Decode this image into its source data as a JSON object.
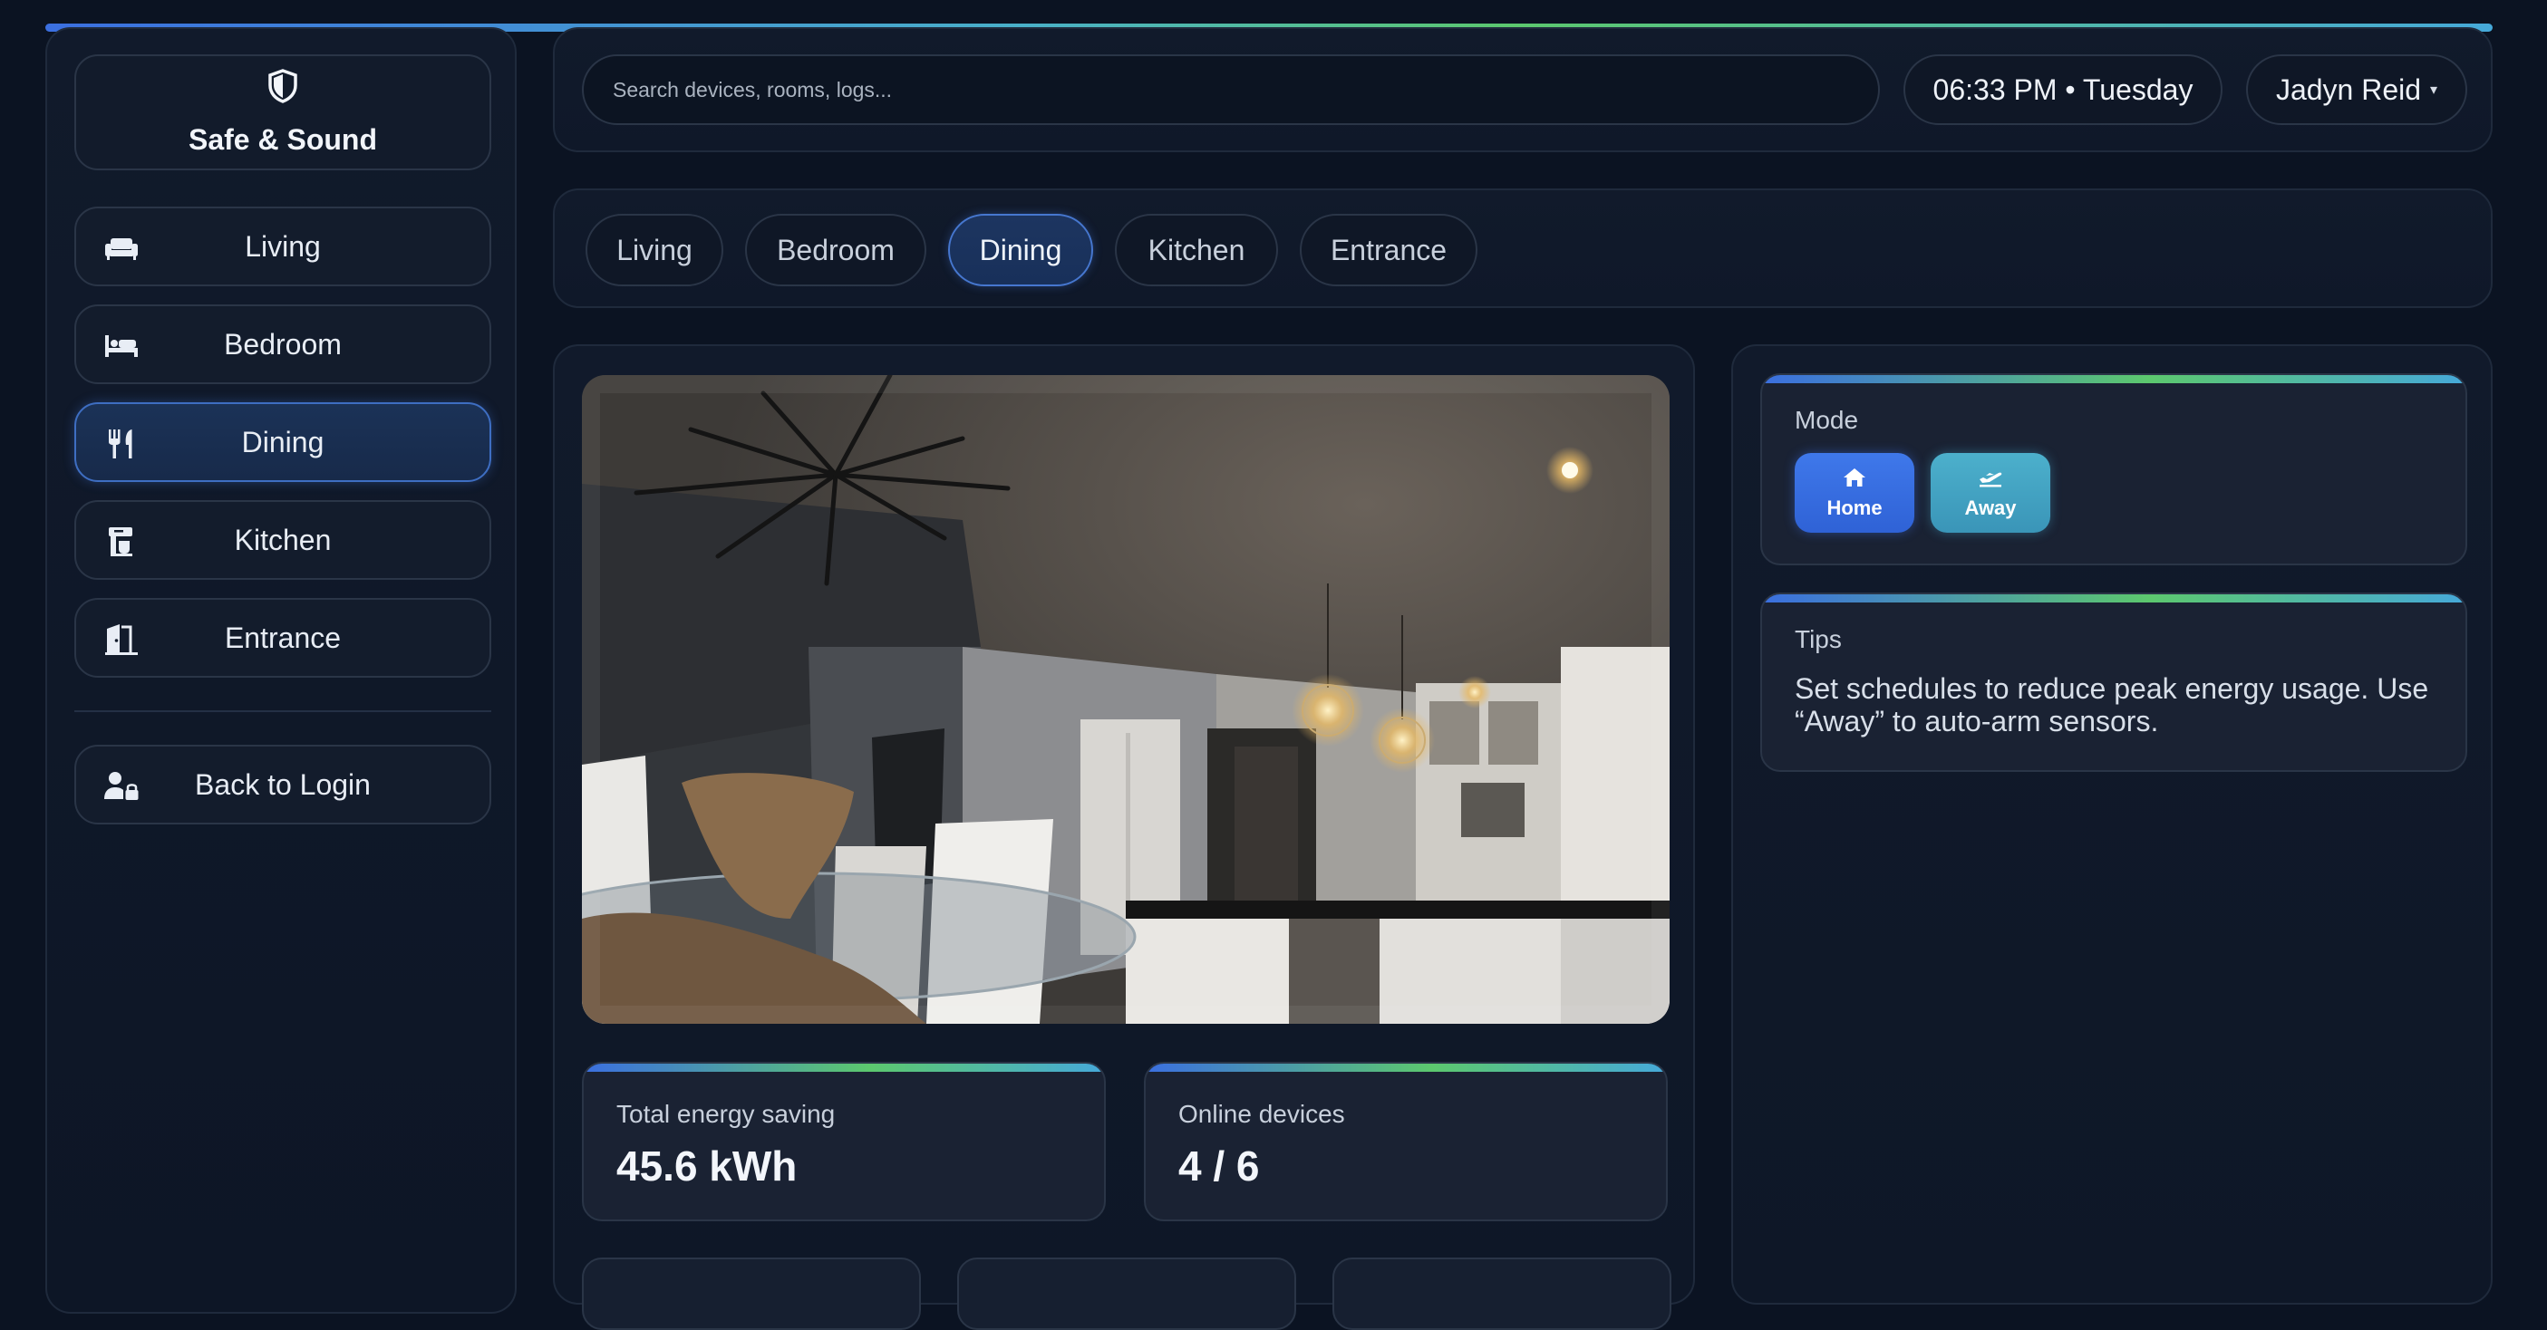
{
  "brand": {
    "name": "Safe & Sound"
  },
  "sidebar": {
    "items": [
      {
        "label": "Living",
        "icon": "sofa-icon"
      },
      {
        "label": "Bedroom",
        "icon": "bed-icon"
      },
      {
        "label": "Dining",
        "icon": "utensils-icon",
        "active": true
      },
      {
        "label": "Kitchen",
        "icon": "coffee-maker-icon"
      },
      {
        "label": "Entrance",
        "icon": "door-open-icon"
      }
    ],
    "logout": {
      "label": "Back to Login",
      "icon": "user-lock-icon"
    }
  },
  "header": {
    "search_placeholder": "Search devices, rooms, logs...",
    "clock": "06:33 PM • Tuesday",
    "user": "Jadyn Reid",
    "user_caret": "▾"
  },
  "tabs": [
    "Living",
    "Bedroom",
    "Dining",
    "Kitchen",
    "Entrance"
  ],
  "active_tab": "Dining",
  "camera": {
    "room": "Dining",
    "scene": "dining-room-camera-feed"
  },
  "stats": [
    {
      "label": "Total energy saving",
      "value": "45.6 kWh"
    },
    {
      "label": "Online devices",
      "value": "4 / 6"
    }
  ],
  "mode": {
    "title": "Mode",
    "buttons": [
      {
        "label": "Home",
        "icon": "home-icon"
      },
      {
        "label": "Away",
        "icon": "plane-departure-icon"
      }
    ]
  },
  "tips": {
    "title": "Tips",
    "text": "Set schedules to reduce peak energy usage. Use “Away” to auto-arm sensors."
  },
  "colors": {
    "accent_blue": "#3b6fe0",
    "accent_green": "#5cc86e",
    "accent_cyan": "#46a9d9",
    "background": "#0b1322"
  }
}
